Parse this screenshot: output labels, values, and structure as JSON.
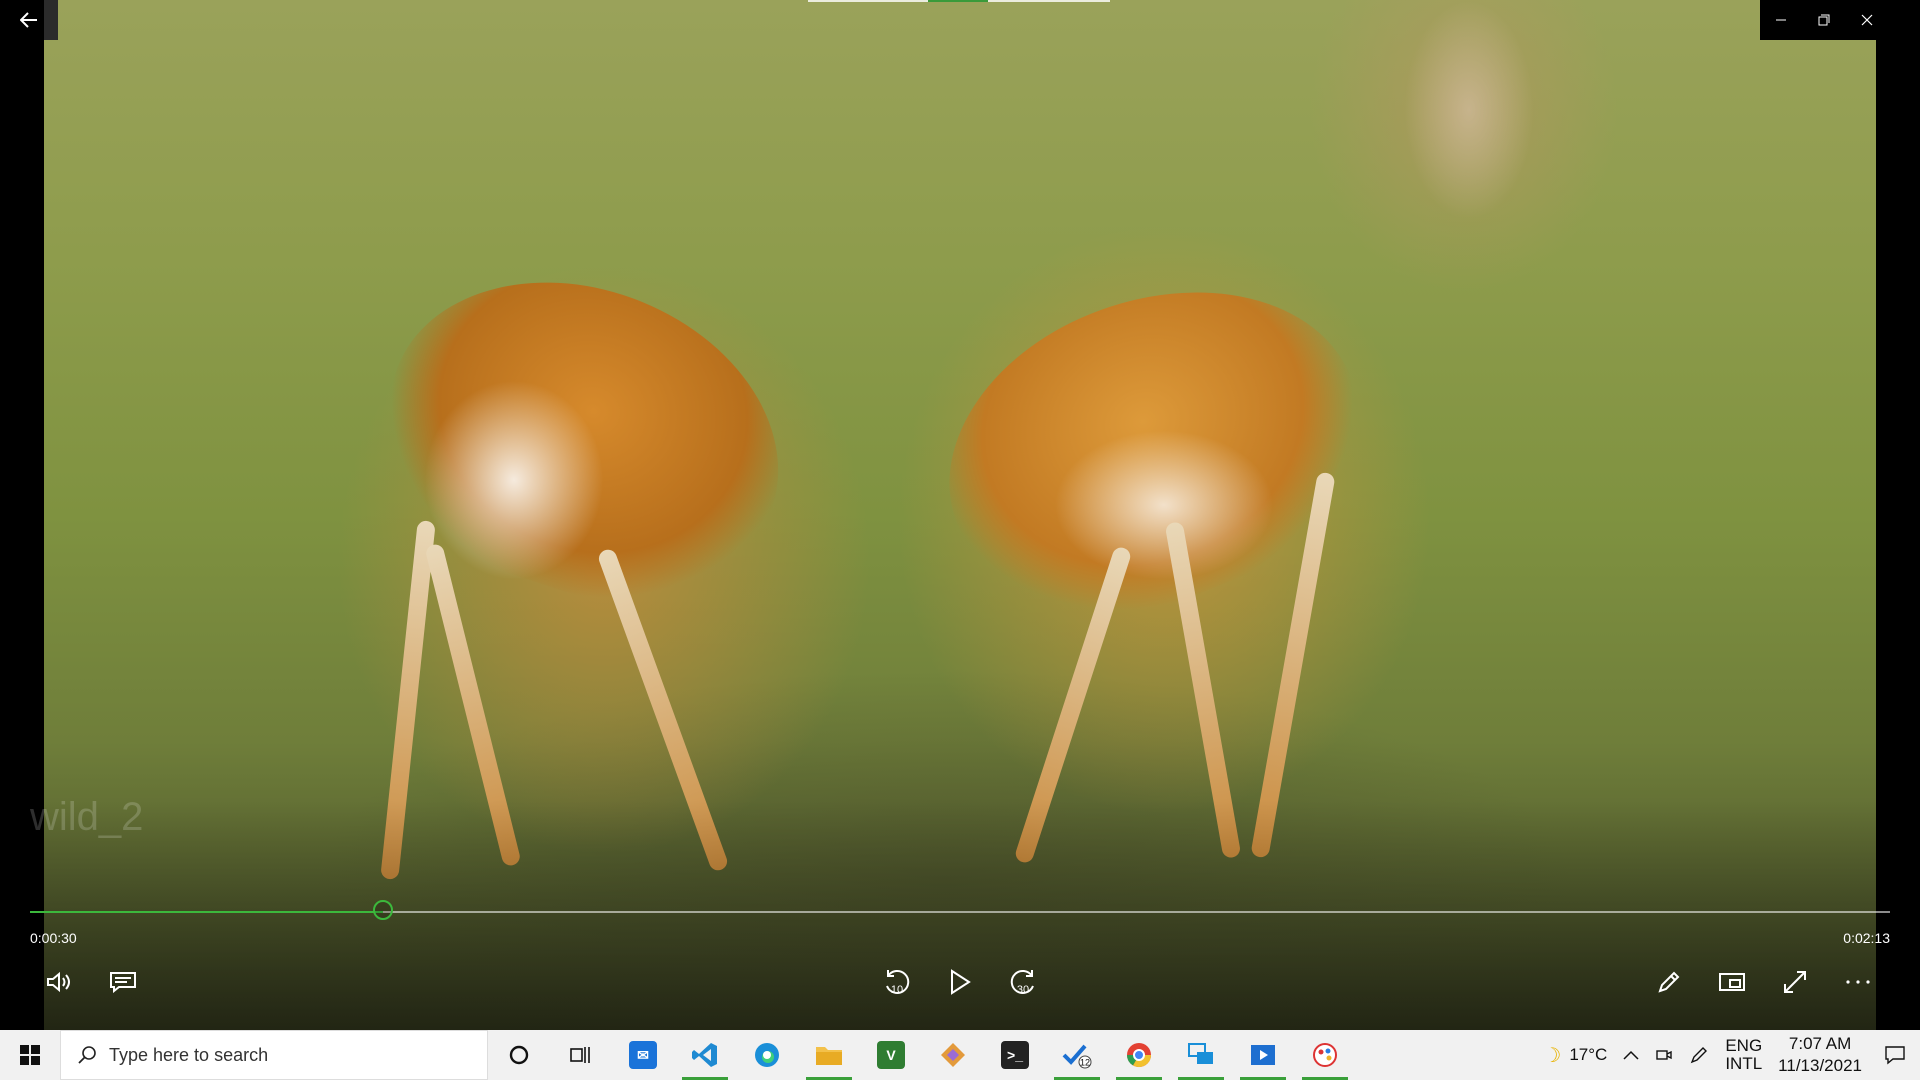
{
  "player": {
    "video_title": "wild_2",
    "current_time": "0:00:30",
    "total_time": "0:02:13",
    "progress_fraction": 0.19,
    "accent_color": "#3cb83c"
  },
  "controls": {
    "skip_back_label": "10",
    "skip_forward_label": "30"
  },
  "taskbar": {
    "search_placeholder": "Type here to search",
    "weather_temp": "17°C",
    "lang_primary": "ENG",
    "lang_secondary": "INTL",
    "time": "7:07 AM",
    "date": "11/13/2021",
    "tasks_badge": "12"
  }
}
